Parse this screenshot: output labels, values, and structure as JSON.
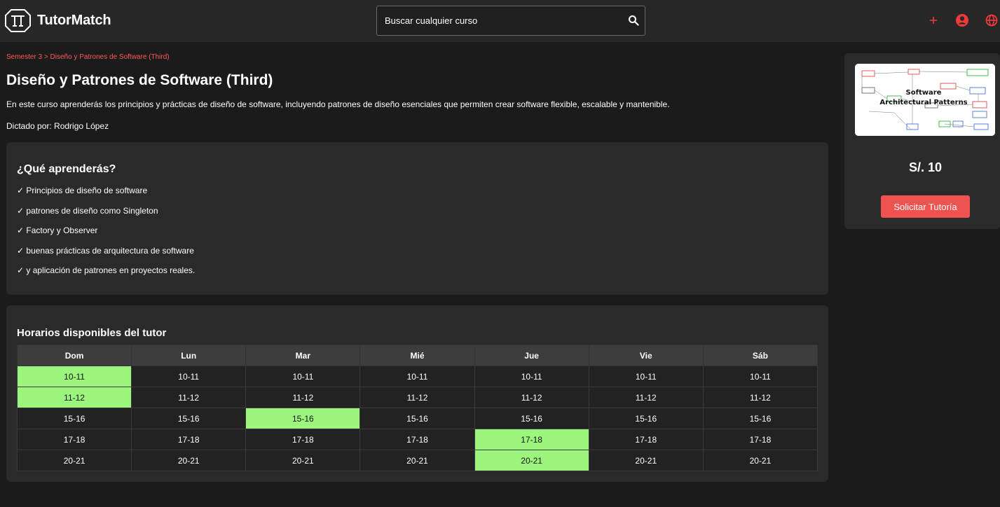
{
  "brand": {
    "name": "TutorMatch",
    "logo_icon": "tutormatch-logo-icon"
  },
  "search": {
    "placeholder": "Buscar cualquier curso",
    "icon": "search-icon"
  },
  "header_icons": [
    {
      "name": "plus-icon",
      "color": "#ef3a3a"
    },
    {
      "name": "user-icon",
      "color": "#ef3a3a"
    },
    {
      "name": "globe-icon",
      "color": "#ef3a3a"
    }
  ],
  "breadcrumb": "Semester 3 > Diseño y Patrones de Software (Third)",
  "course": {
    "title": "Diseño y Patrones de Software (Third)",
    "description": "En este curso aprenderás los principios y prácticas de diseño de software, incluyendo patrones de diseño esenciales que permiten crear software flexible, escalable y mantenible.",
    "tutor_line": "Dictado por: Rodrigo López"
  },
  "learn": {
    "title": "¿Qué aprenderás?",
    "items": [
      "✓ Principios de diseño de software",
      "✓ patrones de diseño como Singleton",
      "✓ Factory y Observer",
      "✓ buenas prácticas de arquitectura de software",
      "✓ y aplicación de patrones en proyectos reales."
    ]
  },
  "schedule": {
    "title": "Horarios disponibles del tutor",
    "days": [
      "Dom",
      "Lun",
      "Mar",
      "Mié",
      "Jue",
      "Vie",
      "Sáb"
    ],
    "slots": [
      "10-11",
      "11-12",
      "15-16",
      "17-18",
      "20-21"
    ],
    "available": [
      [
        0,
        0
      ],
      [
        1,
        0
      ],
      [
        2,
        2
      ],
      [
        3,
        4
      ],
      [
        4,
        4
      ]
    ],
    "available_color": "#9cf57c"
  },
  "sidebar": {
    "image_text": [
      "Software",
      "Architectural Patterns"
    ],
    "price": "S/. 10",
    "cta_label": "Solicitar Tutoría",
    "cta_color": "#ef5350"
  }
}
